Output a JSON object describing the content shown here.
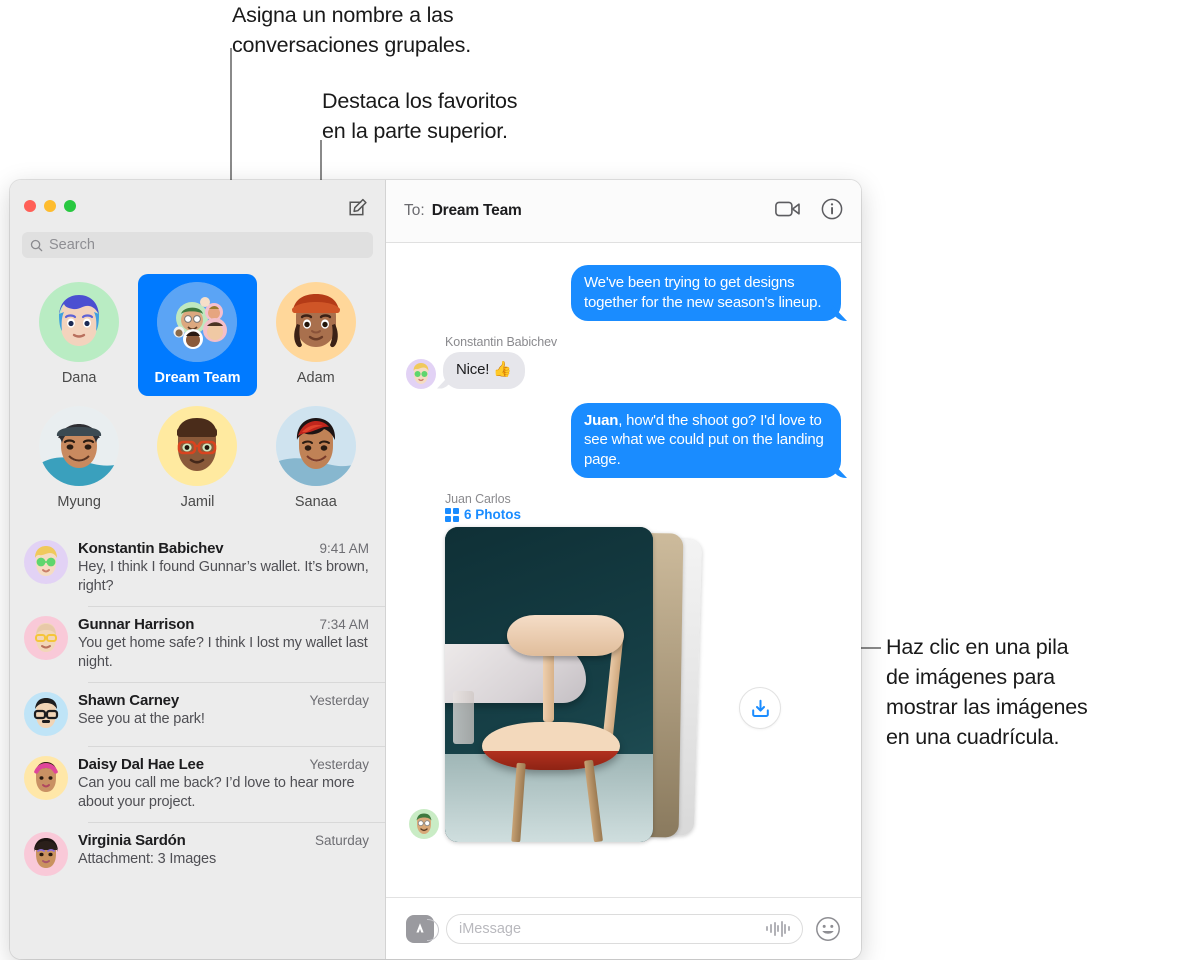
{
  "callouts": [
    {
      "id": "name-group",
      "text": "Asigna un nombre a las\nconversaciones grupales."
    },
    {
      "id": "favorites-top",
      "text": "Destaca los favoritos\nen la parte superior."
    },
    {
      "id": "photo-stack",
      "text": "Haz clic en una pila\nde imágenes para\nmostrar las imágenes\nen una cuadrícula."
    }
  ],
  "window": {
    "traffic_lights": {
      "close": "close-button",
      "minimize": "minimize-button",
      "zoom": "zoom-button"
    },
    "colors": {
      "close": "#ff5f57",
      "minimize": "#febc2e",
      "zoom": "#28c840",
      "accent": "#007aff",
      "bubble_blue": "#1a8cff",
      "bubble_gray": "#e6e6eb",
      "sidebar_bg": "#ececec"
    }
  },
  "sidebar": {
    "compose_icon": "compose-icon",
    "search": {
      "placeholder": "Search",
      "icon": "search-icon"
    },
    "favorites": [
      {
        "name": "Dana",
        "selected": false
      },
      {
        "name": "Dream Team",
        "selected": true
      },
      {
        "name": "Adam",
        "selected": false
      },
      {
        "name": "Myung",
        "selected": false
      },
      {
        "name": "Jamil",
        "selected": false
      },
      {
        "name": "Sanaa",
        "selected": false
      }
    ],
    "conversations": [
      {
        "name": "Konstantin Babichev",
        "time": "9:41 AM",
        "preview": "Hey, I think I found Gunnar’s wallet. It’s brown, right?"
      },
      {
        "name": "Gunnar Harrison",
        "time": "7:34 AM",
        "preview": "You get home safe? I think I lost my wallet last night."
      },
      {
        "name": "Shawn Carney",
        "time": "Yesterday",
        "preview": "See you at the park!"
      },
      {
        "name": "Daisy Dal Hae Lee",
        "time": "Yesterday",
        "preview": "Can you call me back? I’d love to hear more about your project."
      },
      {
        "name": "Virginia Sardón",
        "time": "Saturday",
        "preview": "Attachment: 3 Images"
      }
    ]
  },
  "conversation": {
    "header": {
      "to_label": "To:",
      "recipient": "Dream Team",
      "facetime_icon": "video-camera-icon",
      "details_icon": "info-icon"
    },
    "messages": [
      {
        "type": "outgoing",
        "text": "We've been trying to get designs together for the new season's lineup."
      },
      {
        "type": "incoming",
        "sender": "Konstantin Babichev",
        "text": "Nice!  👍"
      },
      {
        "type": "outgoing",
        "bold_prefix": "Juan",
        "text": ", how'd the shoot go? I'd love to see what we could put on the landing page."
      },
      {
        "type": "attachment",
        "sender": "Juan Carlos",
        "count_label": "6 Photos",
        "grid_icon": "grid-icon",
        "download_icon": "download-icon"
      }
    ],
    "composer": {
      "apps_icon": "apps-store-icon",
      "placeholder": "iMessage",
      "audio_icon": "audio-waveform-icon",
      "emoji_icon": "emoji-smiley-icon"
    }
  }
}
